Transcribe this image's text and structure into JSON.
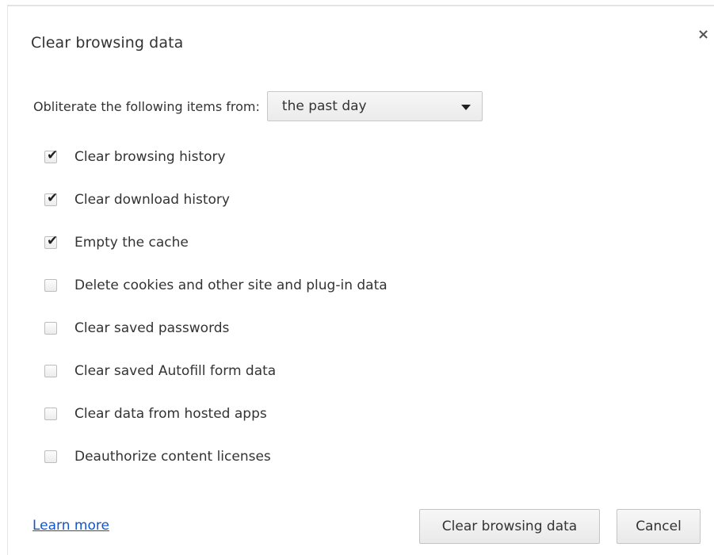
{
  "dialog": {
    "title": "Clear browsing data",
    "close_glyph": "×",
    "close_icon": "close-icon"
  },
  "range": {
    "label": "Obliterate the following items from:",
    "selected": "the past day",
    "arrow_icon": "dropdown-arrow-icon"
  },
  "options": [
    {
      "label": "Clear browsing history",
      "checked": true
    },
    {
      "label": "Clear download history",
      "checked": true
    },
    {
      "label": "Empty the cache",
      "checked": true
    },
    {
      "label": "Delete cookies and other site and plug-in data",
      "checked": false
    },
    {
      "label": "Clear saved passwords",
      "checked": false
    },
    {
      "label": "Clear saved Autofill form data",
      "checked": false
    },
    {
      "label": "Clear data from hosted apps",
      "checked": false
    },
    {
      "label": "Deauthorize content licenses",
      "checked": false
    }
  ],
  "footer": {
    "learn_more": "Learn more",
    "clear_button": "Clear browsing data",
    "cancel_button": "Cancel"
  },
  "colors": {
    "link": "#1155cc",
    "text": "#333333"
  }
}
